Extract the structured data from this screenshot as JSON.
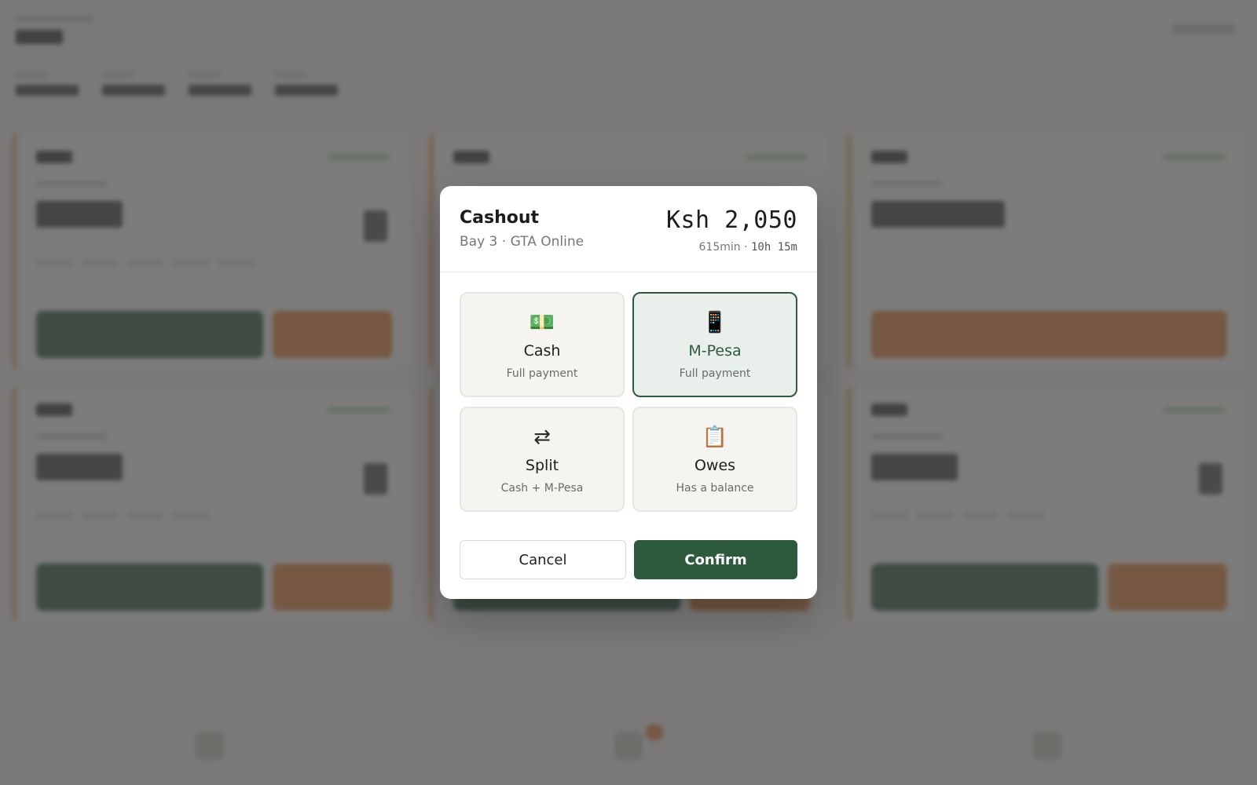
{
  "modal": {
    "title": "Cashout",
    "subtitle": "Bay 3 · GTA Online",
    "amount": "Ksh 2,050",
    "duration_minutes": "615min ·",
    "duration_hm": "10h 15m",
    "methods": [
      {
        "name": "Cash",
        "desc": "Full payment",
        "icon": "💵",
        "icon_name": "cash-icon",
        "selected": false
      },
      {
        "name": "M-Pesa",
        "desc": "Full payment",
        "icon": "📱",
        "icon_name": "mobile-phone-icon",
        "selected": true
      },
      {
        "name": "Split",
        "desc": "Cash + M-Pesa",
        "icon": "⇄",
        "icon_name": "split-arrows-icon",
        "selected": false
      },
      {
        "name": "Owes",
        "desc": "Has a balance",
        "icon": "📋",
        "icon_name": "clipboard-icon",
        "selected": false
      }
    ],
    "cancel_label": "Cancel",
    "confirm_label": "Confirm"
  },
  "colors": {
    "primary_green": "#2d5a3d",
    "accent_orange": "#e6833d",
    "overlay": "rgba(70,70,70,0.70)"
  }
}
